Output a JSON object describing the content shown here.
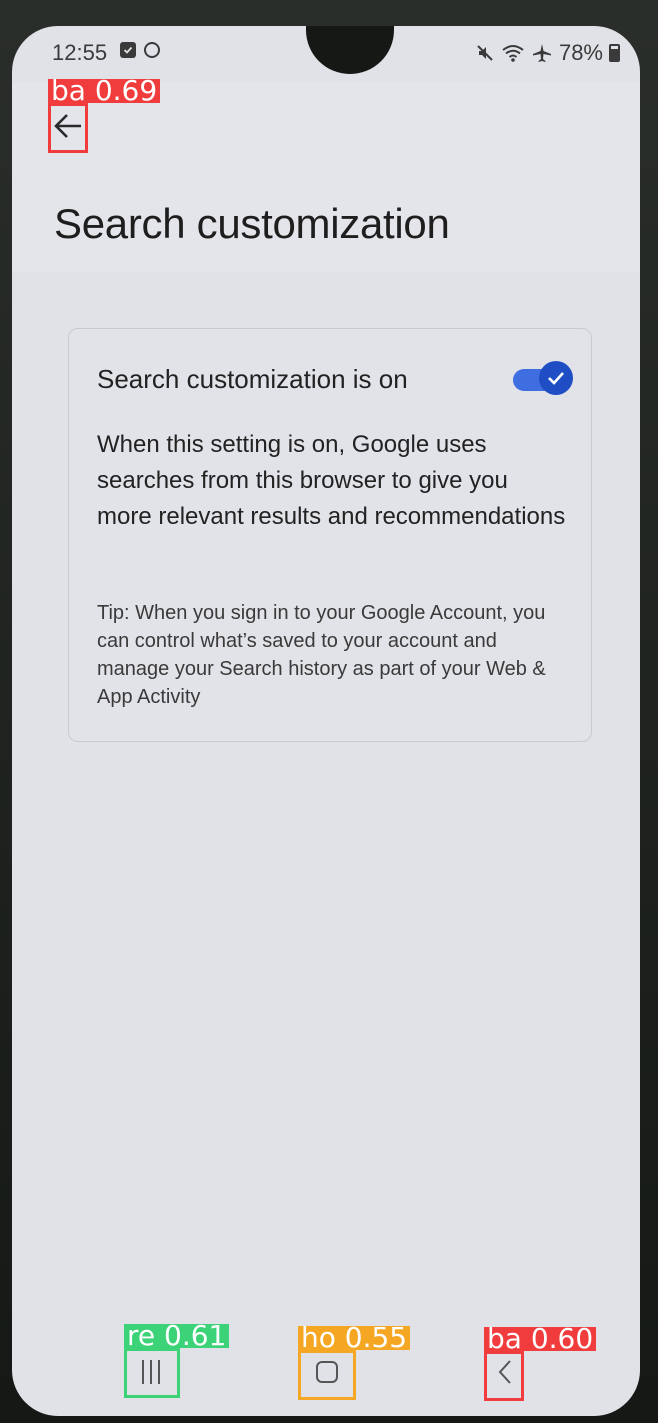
{
  "status_bar": {
    "time": "12:55",
    "battery_percent": "78%",
    "icons": [
      "checkbox-notification-icon",
      "circle-notification-icon",
      "mute-icon",
      "wifi-icon",
      "airplane-icon",
      "battery-icon"
    ]
  },
  "header": {
    "back_icon": "arrow-left-icon",
    "title": "Search customization"
  },
  "card": {
    "toggle_label": "Search customization is on",
    "toggle_on": true,
    "toggle_color": "#1f4ec4",
    "description": "When this setting is on, Google uses searches from this browser to give you more relevant results and recommendations",
    "tip": "Tip: When you sign in to your Google Account, you can control what’s saved to your account and manage your Search history as part of your Web & App Activity"
  },
  "nav_bar": {
    "recents_icon": "recents-icon",
    "home_icon": "home-icon",
    "back_icon": "chevron-left-icon"
  },
  "detections": {
    "back_top": {
      "label": "ba 0.69",
      "color": "#f03c3c"
    },
    "recents": {
      "label": "re 0.61",
      "color": "#3cd278"
    },
    "home": {
      "label": "ho 0.55",
      "color": "#f5a623"
    },
    "back_nav": {
      "label": "ba 0.60",
      "color": "#f03c3c"
    }
  }
}
